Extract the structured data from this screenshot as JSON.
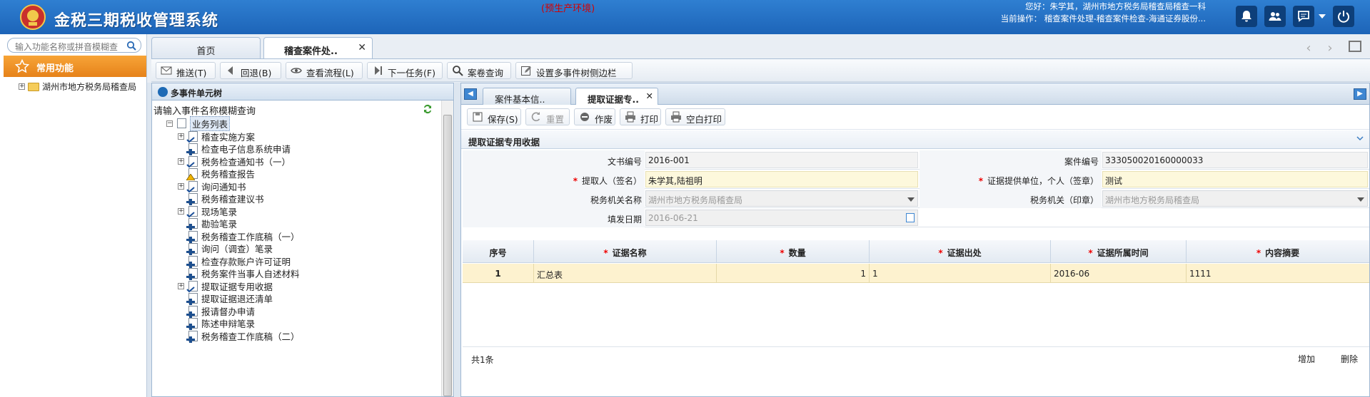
{
  "header": {
    "app_title": "金税三期税收管理系统",
    "env_note": "(预生产环境)",
    "user_line": "您好：朱学其，湖州市地方税务局稽查局稽查一科",
    "current_op_line": "当前操作： 稽查案件处理-稽查案件检查-海通证券股份...",
    "icons": [
      "bell-icon",
      "users-icon",
      "chat-icon",
      "power-icon"
    ]
  },
  "left_nav": {
    "search_placeholder": "输入功能名称或拼音模糊查",
    "favorites_label": "常用功能",
    "tree_root": "湖州市地方税务局稽查局"
  },
  "main_tabs": [
    {
      "label": "首页"
    },
    {
      "label": "稽查案件处.."
    }
  ],
  "toolbar": {
    "push": "推送(T)",
    "back": "回退(B)",
    "view_flow": "查看流程(L)",
    "next_task": "下一任务(F)",
    "case_query": "案卷查询",
    "set_sidebar": "设置多事件树侧边栏"
  },
  "event_tree": {
    "title": "多事件单元树",
    "filter_label": "请输入事件名称模糊查询",
    "root_label": "业务列表",
    "items": [
      {
        "label": "稽查实施方案"
      },
      {
        "label": "检查电子信息系统申请"
      },
      {
        "label": "税务检查通知书（一）"
      },
      {
        "label": "税务稽查报告"
      },
      {
        "label": "询问通知书"
      },
      {
        "label": "税务稽查建议书"
      },
      {
        "label": "现场笔录"
      },
      {
        "label": "勘验笔录"
      },
      {
        "label": "税务稽查工作底稿（一）"
      },
      {
        "label": "询问（调查）笔录"
      },
      {
        "label": "检查存款账户许可证明"
      },
      {
        "label": "税务案件当事人自述材料"
      },
      {
        "label": "提取证据专用收据"
      },
      {
        "label": "提取证据退还清单"
      },
      {
        "label": "报请督办申请"
      },
      {
        "label": "陈述申辩笔录"
      },
      {
        "label": "税务稽查工作底稿（二）"
      }
    ]
  },
  "sub_tabs": [
    {
      "label": "案件基本信.."
    },
    {
      "label": "提取证据专.."
    }
  ],
  "form_toolbar": {
    "save": "保存(S)",
    "reset": "重置",
    "void": "作废",
    "print": "打印",
    "blank_print": "空白打印"
  },
  "form": {
    "section_title": "提取证据专用收据",
    "doc_no_label": "文书编号",
    "doc_no": "2016-001",
    "case_no_label": "案件编号",
    "case_no": "333050020160000033",
    "extractor_label": "提取人（签名）",
    "extractor": "朱学其,陆祖明",
    "provider_label": "证据提供单位，个人（签章）",
    "provider": "测试",
    "tax_org_label": "税务机关名称",
    "tax_org": "湖州市地方税务局稽查局",
    "tax_seal_label": "税务机关（印章）",
    "tax_seal": "湖州市地方税务局稽查局",
    "issue_date_label": "填发日期",
    "issue_date": "2016-06-21"
  },
  "grid": {
    "headers": [
      "序号",
      "证据名称",
      "数量",
      "证据出处",
      "证据所属时间",
      "内容摘要"
    ],
    "rows": [
      {
        "no": "1",
        "name": "汇总表",
        "qty": "1",
        "source": "1",
        "time": "2016-06",
        "summary": "1111"
      }
    ],
    "total": "共1条",
    "add": "增加",
    "delete": "删除"
  }
}
